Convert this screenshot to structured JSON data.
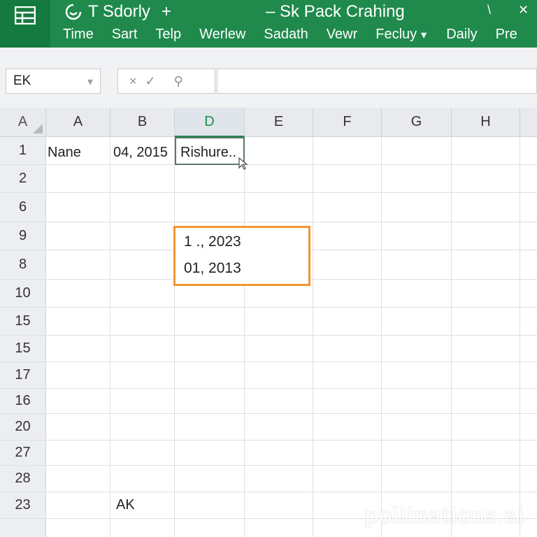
{
  "titlebar": {
    "app_icon": "spreadsheet-grid-icon",
    "left_title": "T Sdorly",
    "add_symbol": "+",
    "center_title": "– Sk Pack Crahing",
    "minimize_symbol": "\\",
    "close_symbol": "✕",
    "accent_color": "#1f8a4c"
  },
  "menu": {
    "items": [
      "Time",
      "Sart",
      "Telp",
      "Werlew",
      "Sadath",
      "Vewr",
      "Fecluy",
      "Daily",
      "Pre"
    ],
    "dropdown_caret": "▾"
  },
  "formula_bar": {
    "name_box": "EK",
    "name_box_caret": "▾",
    "tools": [
      "×",
      "✓",
      "⚲"
    ]
  },
  "grid": {
    "corner_label": "A",
    "columns": [
      "A",
      "B",
      "D",
      "E",
      "F",
      "G",
      "H"
    ],
    "active_column": "D",
    "rows": [
      "1",
      "2",
      "6",
      "9",
      "8",
      "10",
      "15",
      "15",
      "17",
      "16",
      "20",
      "27",
      "28",
      "23"
    ],
    "cells": {
      "r1_a": "Nane",
      "r1_b": "04, 2015",
      "r1_d": "Rishure..",
      "r23_b": "AK"
    }
  },
  "popup": {
    "line1": "1 ., 2023",
    "line2": "01, 2013",
    "border_color": "#f0962e"
  },
  "watermark": "pollinations.ai"
}
